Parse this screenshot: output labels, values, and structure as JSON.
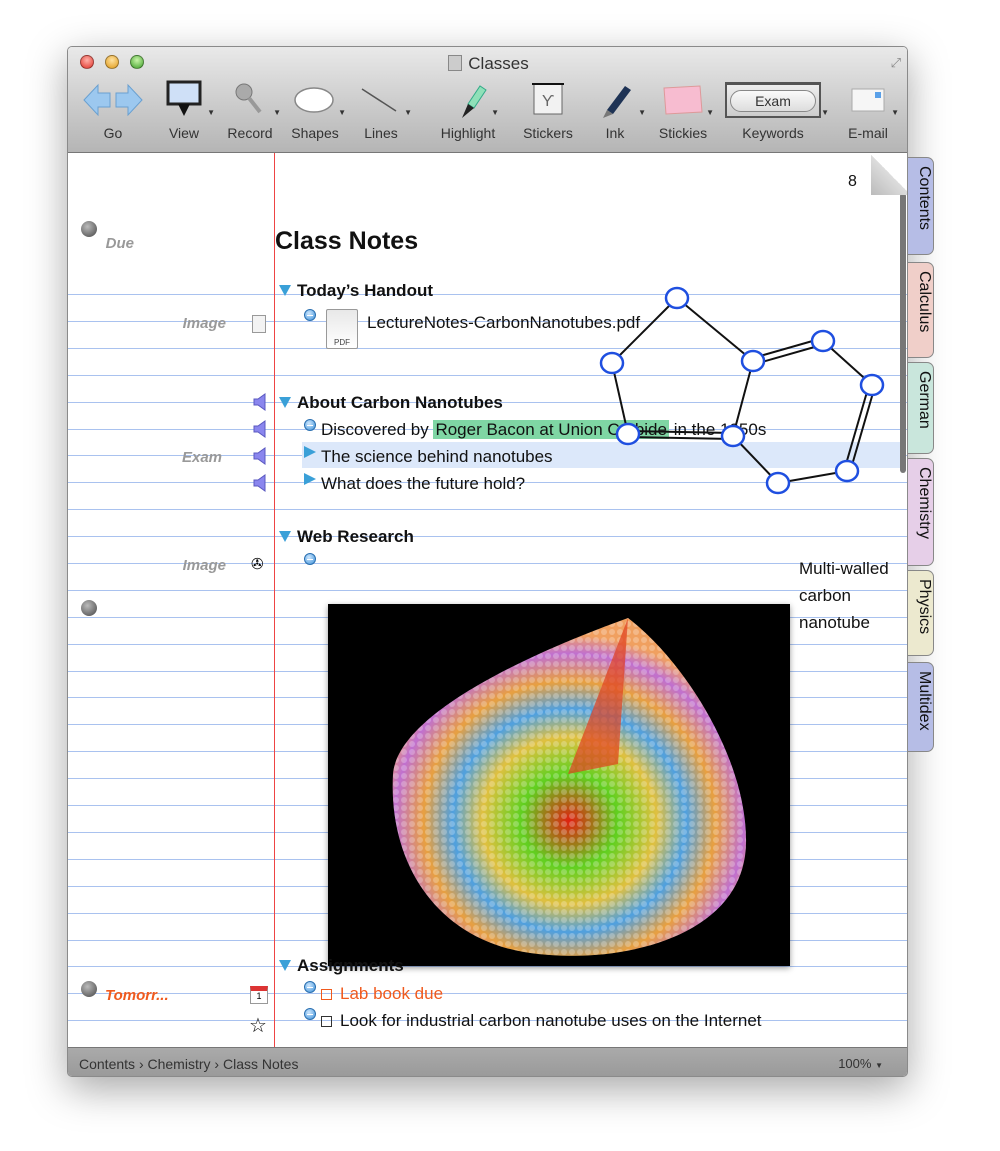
{
  "window": {
    "title": "Classes"
  },
  "toolbar": [
    {
      "label": "Go",
      "icon": "back-forward-arrows-icon"
    },
    {
      "label": "View",
      "icon": "view-icon"
    },
    {
      "label": "Record",
      "icon": "microphone-icon"
    },
    {
      "label": "Shapes",
      "icon": "ellipse-icon"
    },
    {
      "label": "Lines",
      "icon": "line-icon"
    },
    {
      "label": "Highlight",
      "icon": "highlighter-icon"
    },
    {
      "label": "Stickers",
      "icon": "sticker-icon"
    },
    {
      "label": "Ink",
      "icon": "pen-icon"
    },
    {
      "label": "Stickies",
      "icon": "sticky-note-icon"
    },
    {
      "label": "Keywords",
      "icon": "keyword-icon",
      "keyword": "Exam"
    },
    {
      "label": "E-mail",
      "icon": "envelope-icon"
    }
  ],
  "page": {
    "number": "8",
    "title": "Class Notes"
  },
  "sections": {
    "handout": {
      "title": "Today’s Handout",
      "file": "LectureNotes-CarbonNanotubes.pdf",
      "file_icon_label": "PDF",
      "margin_label": "Image"
    },
    "about": {
      "title": "About Carbon Nanotubes",
      "item1_pre": "Discovered by ",
      "item1_highlight": "Roger Bacon at Union Carbide",
      "item1_post": " in the 1950s",
      "item2": "The science behind nanotubes",
      "item2_label": "Exam",
      "item3": "What does the future hold?",
      "highlight_color": "#7fd6a4"
    },
    "web": {
      "title": "Web Research",
      "margin_label": "Image",
      "caption": [
        "Multi-walled",
        "carbon",
        "nanotube"
      ]
    },
    "assignments": {
      "title": "Assignments",
      "item1": "Lab book due",
      "item1_label": "Tomorr...",
      "item1_color": "#f05a1e",
      "item2": "Look for industrial carbon nanotube uses on the Internet"
    }
  },
  "margin": {
    "due_label": "Due"
  },
  "tabs": [
    {
      "label": "Contents",
      "color": "#b6bde6"
    },
    {
      "label": "Calculus",
      "color": "#f0cfc9"
    },
    {
      "label": "German",
      "color": "#c9e6dc"
    },
    {
      "label": "Chemistry",
      "color": "#e6cfe8"
    },
    {
      "label": "Physics",
      "color": "#ece9cf"
    },
    {
      "label": "Multidex",
      "color": "#b6bde6"
    }
  ],
  "status": {
    "breadcrumb": [
      "Contents",
      "Chemistry",
      "Class Notes"
    ],
    "separator": "›",
    "zoom": "100%"
  }
}
